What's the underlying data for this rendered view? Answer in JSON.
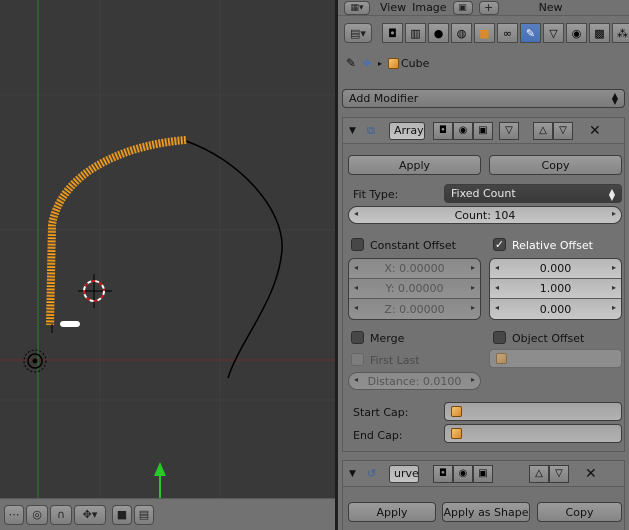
{
  "top_bar": {
    "menu_view": "View",
    "menu_image": "Image",
    "new_label": "New"
  },
  "breadcrumb": {
    "object_name": "Cube"
  },
  "add_modifier": {
    "label": "Add Modifier"
  },
  "array_modifier": {
    "name": "Array",
    "apply_label": "Apply",
    "copy_label": "Copy",
    "fit_type_label": "Fit Type:",
    "fit_type_value": "Fixed Count",
    "count_text": "Count: 104",
    "constant_offset_label": "Constant Offset",
    "constant_offset_checked": false,
    "relative_offset_label": "Relative Offset",
    "relative_offset_checked": true,
    "constant_x": "X: 0.00000",
    "constant_y": "Y: 0.00000",
    "constant_z": "Z: 0.00000",
    "relative_x": "0.000",
    "relative_y": "1.000",
    "relative_z": "0.000",
    "merge_label": "Merge",
    "merge_checked": false,
    "object_offset_label": "Object Offset",
    "object_offset_checked": false,
    "first_last_label": "First Last",
    "distance_text": "Distance: 0.0100",
    "start_cap_label": "Start Cap:",
    "end_cap_label": "End Cap:"
  },
  "curve_modifier": {
    "name": "urve",
    "apply_label": "Apply",
    "apply_as_shape_label": "Apply as Shape",
    "copy_label": "Copy"
  },
  "icons": [
    "pin-icon",
    "scene-icon",
    "cube-icon",
    "wrench-icon",
    "camera-icon",
    "eye-icon",
    "edit-mode-icon",
    "vertex-icon",
    "close-icon",
    "curve-icon",
    "array-icon",
    "clapper-icon",
    "cursor-icon",
    "light-icon"
  ],
  "colors": {
    "accent_blue": "#5a7fc0",
    "array_orange": "#f4a324",
    "axis_green": "#27c827",
    "axis_red": "#7a2a2a"
  }
}
